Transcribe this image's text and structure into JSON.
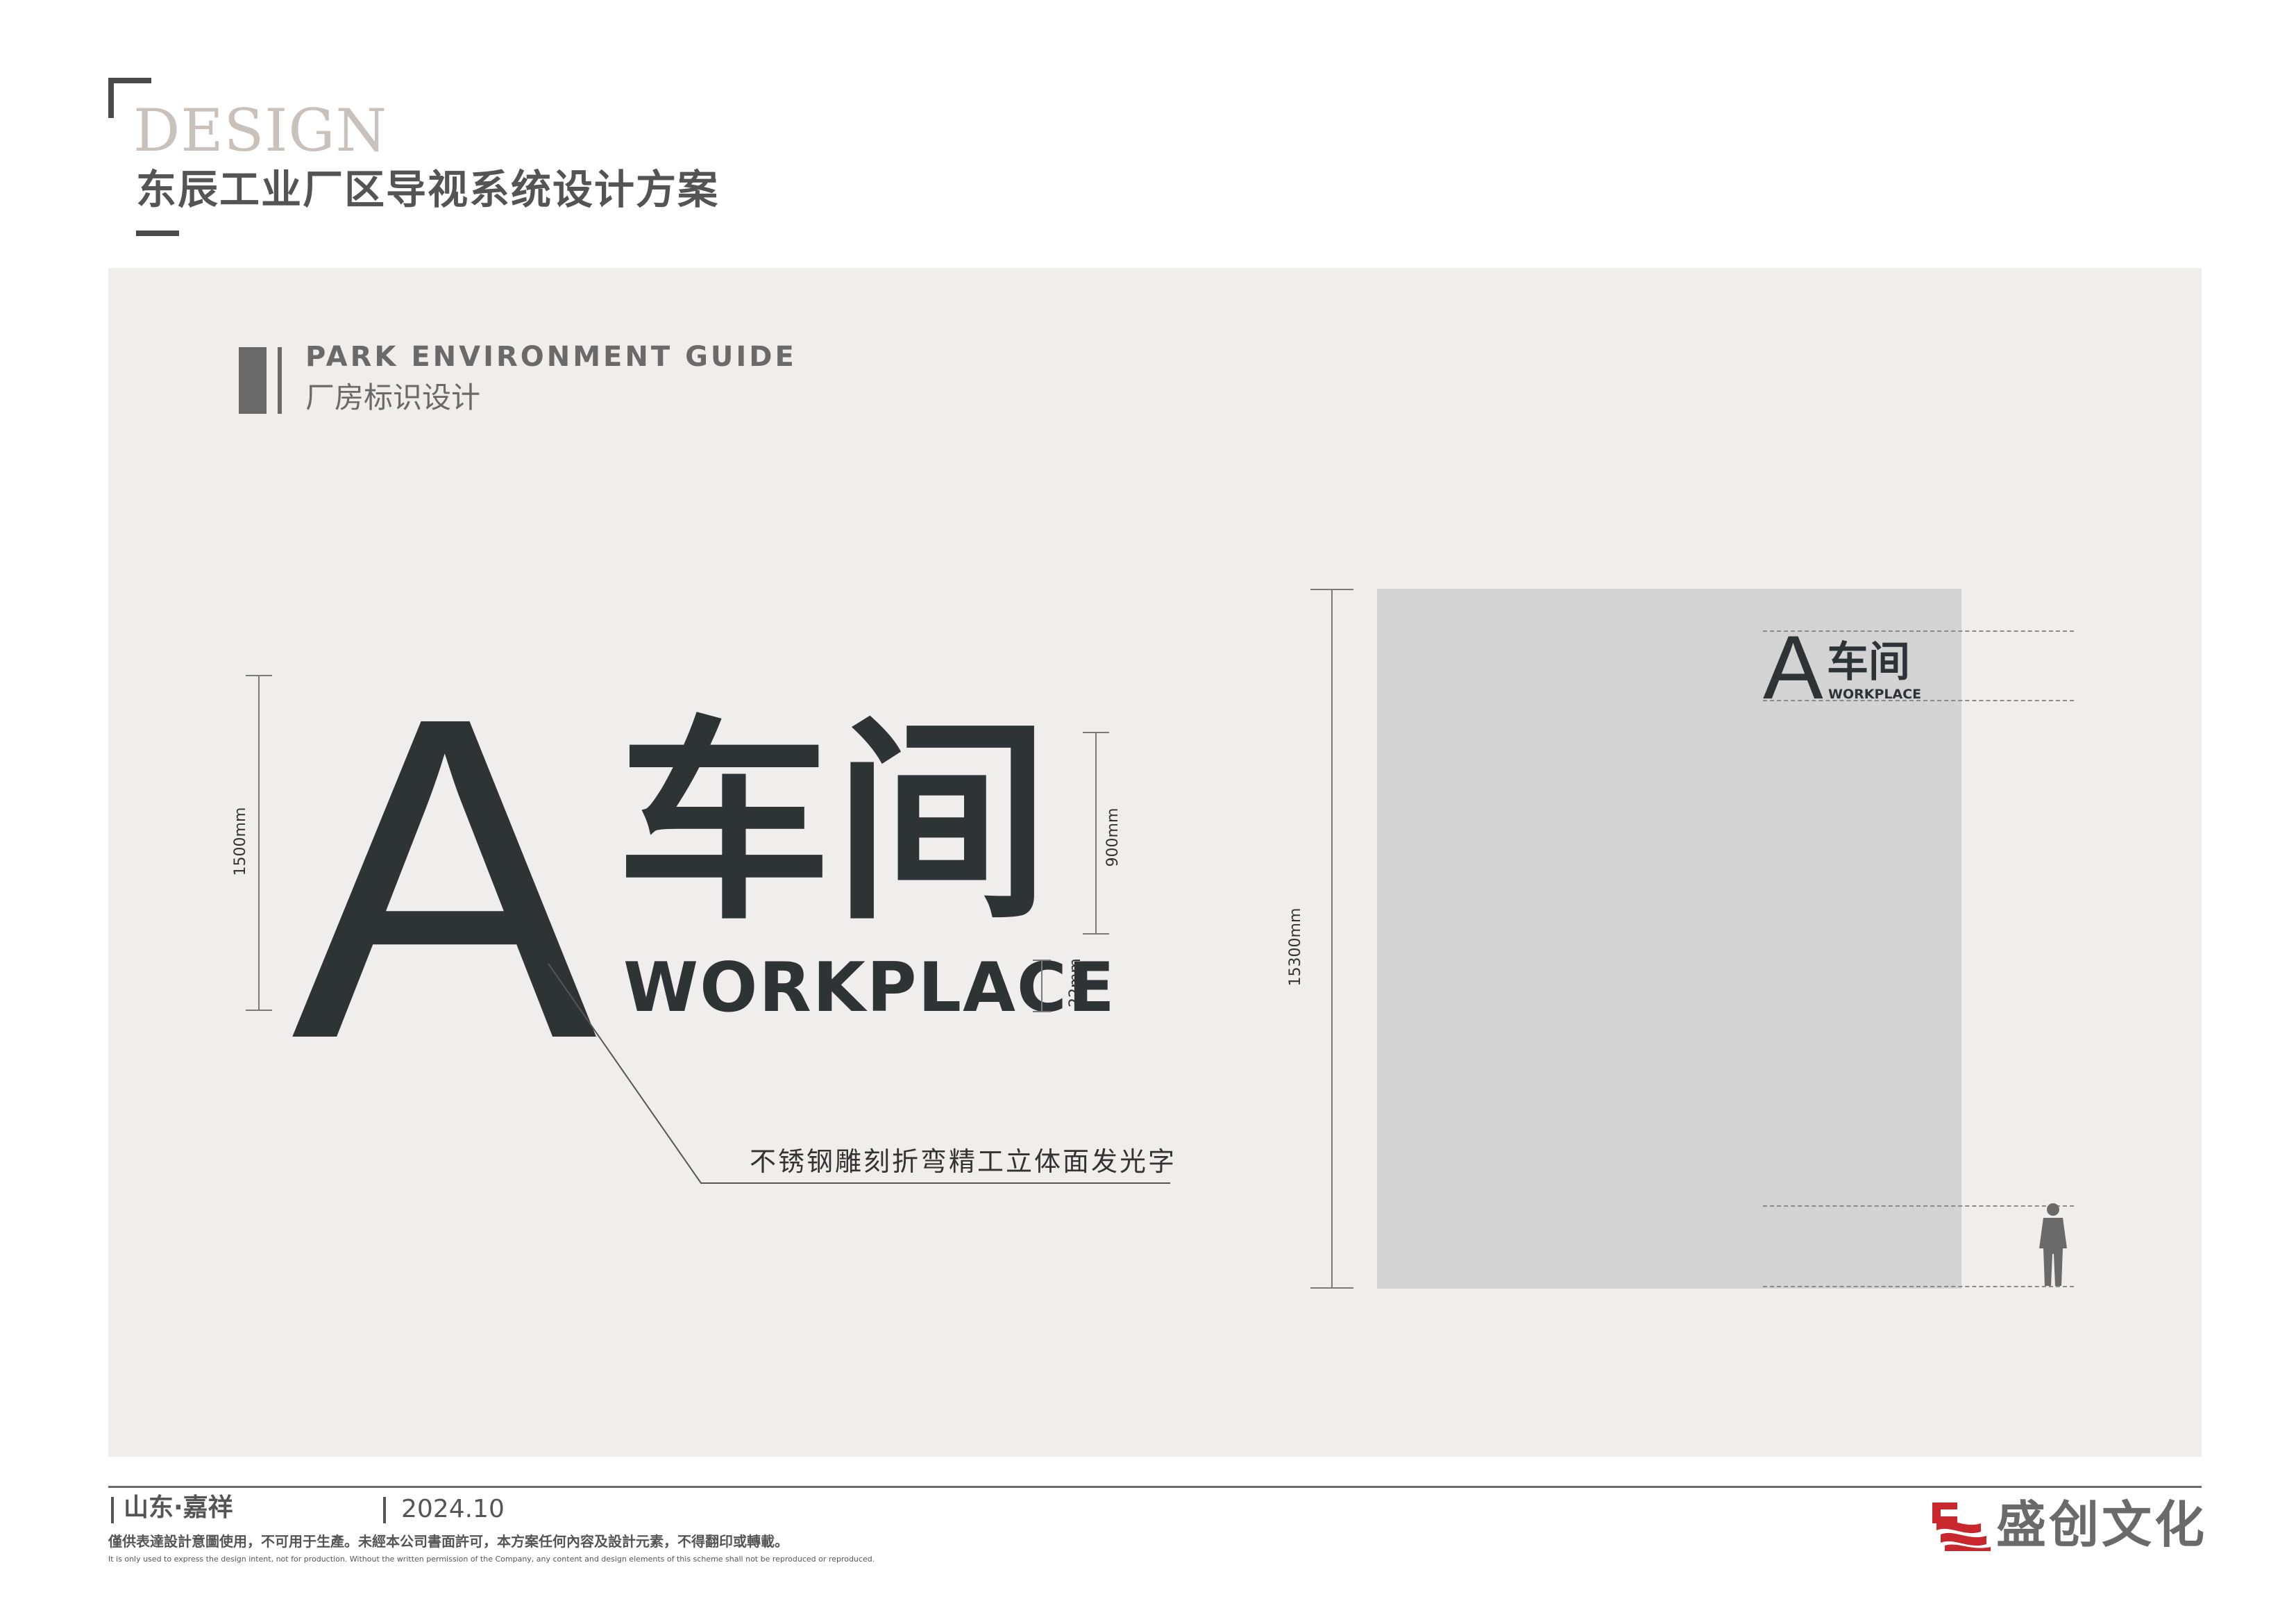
{
  "header": {
    "brand_word": "DESIGN",
    "doc_title": "东辰工业厂区导视系统设计方案"
  },
  "section": {
    "title_en": "PARK ENVIRONMENT GUIDE",
    "title_cn": "厂房标识设计"
  },
  "sign": {
    "letter": "A",
    "name_cn": "车间",
    "name_en": "WORKPLACE",
    "dim_total": "1500mm",
    "dim_cn": "900mm",
    "dim_en": "22mm",
    "material_note": "不锈钢雕刻折弯精工立体面发光字"
  },
  "elevation": {
    "dim_height": "15300mm",
    "letter": "A",
    "name_cn": "车间",
    "name_en": "WORKPLACE",
    "wall_color": "#d3d3d3"
  },
  "footer": {
    "location": "山东·嘉祥",
    "date": "2024.10",
    "disclaimer_cn": "僅供表達設計意圖使用，不可用于生產。未經本公司書面許可，本方案任何內容及設計元素，不得翻印或轉載。",
    "disclaimer_en": "It is only used to express the design intent, not for production. Without the written permission of the Company, any content and design elements of this scheme shall not be reproduced or reproduced.",
    "company": "盛创文化"
  },
  "colors": {
    "ink": "#2e3436",
    "panel": "#f0eded",
    "accent_red": "#c8272d"
  }
}
